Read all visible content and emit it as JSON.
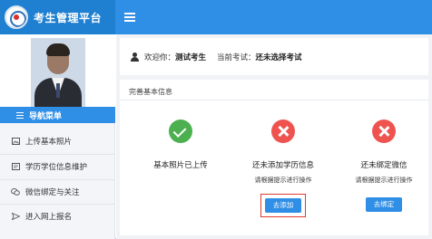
{
  "app": {
    "title": "考生管理平台"
  },
  "sidebar": {
    "menu_title": "导航菜单",
    "items": [
      {
        "label": "上传基本照片",
        "icon": "image-icon"
      },
      {
        "label": "学历学位信息维护",
        "icon": "id-card-icon"
      },
      {
        "label": "微信绑定与关注",
        "icon": "wechat-icon"
      },
      {
        "label": "进入网上报名",
        "icon": "send-icon"
      }
    ]
  },
  "header": {
    "welcome_prefix": "欢迎你：",
    "user_name": "测试考生",
    "exam_prefix": "当前考试：",
    "exam_value": "还未选择考试"
  },
  "card": {
    "title": "完善基本信息",
    "statuses": [
      {
        "state": "done",
        "text": "基本照片已上传",
        "sub": "",
        "button": ""
      },
      {
        "state": "todo",
        "text": "还未添加学历信息",
        "sub": "请根据提示进行操作",
        "button": "去添加"
      },
      {
        "state": "todo",
        "text": "还未绑定微信",
        "sub": "请根据提示进行操作",
        "button": "去绑定"
      }
    ]
  },
  "colors": {
    "brand": "#1f7fd0",
    "accent": "#2f8ee5",
    "success": "#4caf50",
    "danger": "#ef5350",
    "highlight_border": "#e03a2f"
  }
}
